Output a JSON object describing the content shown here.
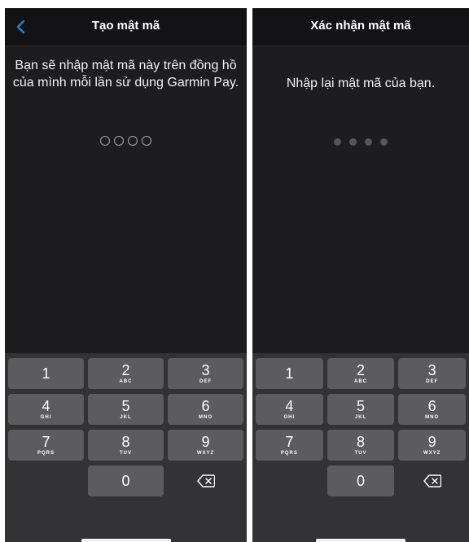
{
  "colors": {
    "background": "#1d1d1f",
    "navbar": "#131315",
    "keypad_background": "#333336",
    "key": "#5c5c60",
    "accent": "#2d7bd6",
    "text": "#ffffff"
  },
  "screens": [
    {
      "title": "Tạo mật mã",
      "back_icon": "chevron-left-icon",
      "prompt": "Bạn sẽ nhập mật mã này trên đồng hồ của mình mỗi lần sử dụng Garmin Pay.",
      "pin_length": 4,
      "pin_entered": 0
    },
    {
      "title": "Xác nhận mật mã",
      "prompt": "Nhập lại mật mã của bạn.",
      "pin_length": 4,
      "pin_entered": 0
    }
  ],
  "keypad": {
    "keys": [
      {
        "digit": "1",
        "letters": ""
      },
      {
        "digit": "2",
        "letters": "ABC"
      },
      {
        "digit": "3",
        "letters": "DEF"
      },
      {
        "digit": "4",
        "letters": "GHI"
      },
      {
        "digit": "5",
        "letters": "JKL"
      },
      {
        "digit": "6",
        "letters": "MNO"
      },
      {
        "digit": "7",
        "letters": "PQRS"
      },
      {
        "digit": "8",
        "letters": "TUV"
      },
      {
        "digit": "9",
        "letters": "WXYZ"
      },
      {
        "digit": "0",
        "letters": ""
      }
    ],
    "delete_icon": "backspace-icon"
  }
}
